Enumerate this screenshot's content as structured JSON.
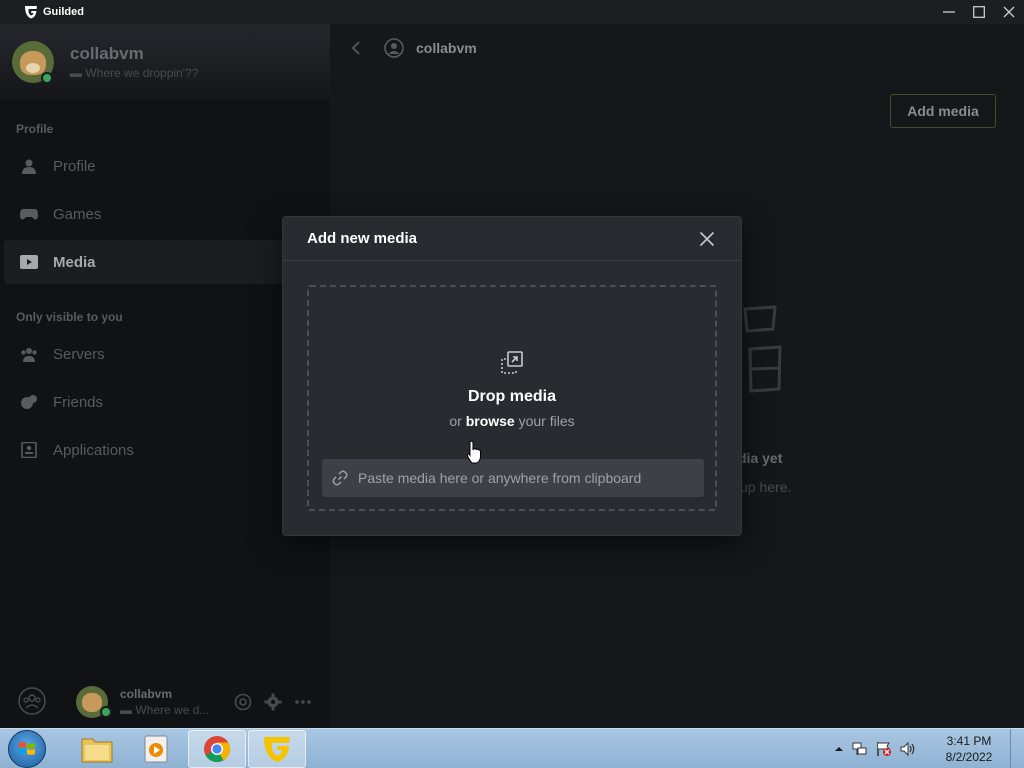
{
  "titlebar": {
    "app_name": "Guilded"
  },
  "sidebar": {
    "username": "collabvm",
    "status": "Where we droppin'??",
    "sections": {
      "profile_label": "Profile",
      "private_label": "Only visible to you"
    },
    "items": [
      {
        "label": "Profile"
      },
      {
        "label": "Games"
      },
      {
        "label": "Media"
      },
      {
        "label": "Servers"
      },
      {
        "label": "Friends"
      },
      {
        "label": "Applications"
      }
    ],
    "footer": {
      "username": "collabvm",
      "status": "Where we d..."
    }
  },
  "main": {
    "header_username": "collabvm",
    "add_media_label": "Add media",
    "empty_title": "dia yet",
    "empty_sub": "up here."
  },
  "modal": {
    "title": "Add new media",
    "drop_title": "Drop media",
    "drop_sub_prefix": "or ",
    "drop_sub_link": "browse",
    "drop_sub_suffix": " your files",
    "paste_text": "Paste media here or anywhere from clipboard"
  },
  "taskbar": {
    "time": "3:41 PM",
    "date": "8/2/2022"
  },
  "colors": {
    "accent": "#f5c400",
    "online": "#3ba55c"
  }
}
